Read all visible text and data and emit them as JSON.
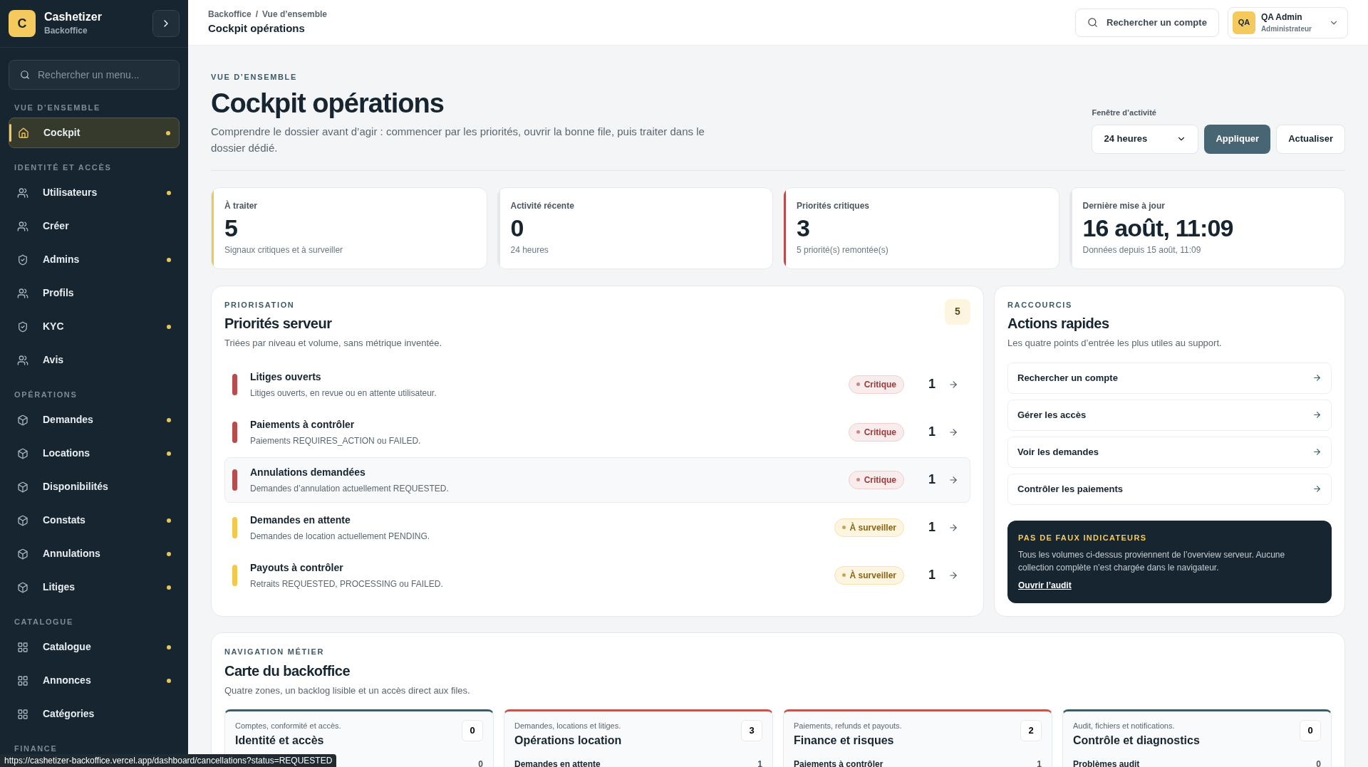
{
  "brand": {
    "initial": "C",
    "name": "Cashetizer",
    "subtitle": "Backoffice"
  },
  "sidebar": {
    "search_placeholder": "Rechercher un menu...",
    "sections": [
      {
        "title": "VUE D’ENSEMBLE",
        "items": [
          {
            "label": "Cockpit",
            "kind": "home",
            "selected": true,
            "flagged": true
          }
        ]
      },
      {
        "title": "IDENTITÉ ET ACCÈS",
        "items": [
          {
            "label": "Utilisateurs",
            "kind": "users",
            "selected": false,
            "flagged": true
          },
          {
            "label": "Créer",
            "kind": "users",
            "selected": false,
            "flagged": false
          },
          {
            "label": "Admins",
            "kind": "shield",
            "selected": false,
            "flagged": true
          },
          {
            "label": "Profils",
            "kind": "users",
            "selected": false,
            "flagged": false
          },
          {
            "label": "KYC",
            "kind": "shield",
            "selected": false,
            "flagged": true
          },
          {
            "label": "Avis",
            "kind": "users",
            "selected": false,
            "flagged": false
          }
        ]
      },
      {
        "title": "OPÉRATIONS",
        "items": [
          {
            "label": "Demandes",
            "kind": "box",
            "selected": false,
            "flagged": true
          },
          {
            "label": "Locations",
            "kind": "box",
            "selected": false,
            "flagged": true
          },
          {
            "label": "Disponibilités",
            "kind": "box",
            "selected": false,
            "flagged": false
          },
          {
            "label": "Constats",
            "kind": "box",
            "selected": false,
            "flagged": true
          },
          {
            "label": "Annulations",
            "kind": "box",
            "selected": false,
            "flagged": true
          },
          {
            "label": "Litiges",
            "kind": "box",
            "selected": false,
            "flagged": true
          }
        ]
      },
      {
        "title": "CATALOGUE",
        "items": [
          {
            "label": "Catalogue",
            "kind": "grid",
            "selected": false,
            "flagged": true
          },
          {
            "label": "Annonces",
            "kind": "grid",
            "selected": false,
            "flagged": true
          },
          {
            "label": "Catégories",
            "kind": "grid",
            "selected": false,
            "flagged": false
          }
        ]
      },
      {
        "title": "FINANCE"
      }
    ]
  },
  "header": {
    "breadcrumb": [
      "Backoffice",
      "Vue d’ensemble"
    ],
    "separator": "/",
    "title": "Cockpit opérations",
    "search_label": "Rechercher un compte",
    "user": {
      "initials": "QA",
      "name": "QA Admin",
      "role": "Administrateur"
    }
  },
  "hero": {
    "eyebrow": "VUE D’ENSEMBLE",
    "title": "Cockpit opérations",
    "description": "Comprendre le dossier avant d’agir : commencer par les priorités, ouvrir la bonne file, puis traiter dans le dossier dédié.",
    "window_label": "Fenêtre d’activité",
    "window_value": "24 heures",
    "apply": "Appliquer",
    "refresh": "Actualiser"
  },
  "kpis": [
    {
      "label": "À traiter",
      "value": "5",
      "note": "Signaux critiques et à surveiller",
      "color": "#f2c94c"
    },
    {
      "label": "Activité récente",
      "value": "0",
      "note": "24 heures",
      "color": "#e5e7eb"
    },
    {
      "label": "Priorités critiques",
      "value": "3",
      "note": "5 priorité(s) remontée(s)",
      "color": "#b84b4b"
    },
    {
      "label": "Dernière mise à jour",
      "value": "16 août, 11:09",
      "note": "Données depuis 15 août, 11:09",
      "color": "#e5e7eb"
    }
  ],
  "priorities": {
    "eyebrow": "PRIORISATION",
    "title": "Priorités serveur",
    "subtitle": "Triées par niveau et volume, sans métrique inventée.",
    "count": "5",
    "rows": [
      {
        "title": "Litiges ouverts",
        "detail": "Litiges ouverts, en revue ou en attente utilisateur.",
        "kind": "critical",
        "badge": "Critique",
        "count": "1",
        "selected": false
      },
      {
        "title": "Paiements à contrôler",
        "detail": "Paiements REQUIRES_ACTION ou FAILED.",
        "kind": "critical",
        "badge": "Critique",
        "count": "1",
        "selected": false
      },
      {
        "title": "Annulations demandées",
        "detail": "Demandes d’annulation actuellement REQUESTED.",
        "kind": "critical",
        "badge": "Critique",
        "count": "1",
        "selected": true
      },
      {
        "title": "Demandes en attente",
        "detail": "Demandes de location actuellement PENDING.",
        "kind": "watch",
        "badge": "À surveiller",
        "count": "1",
        "selected": false
      },
      {
        "title": "Payouts à contrôler",
        "detail": "Retraits REQUESTED, PROCESSING ou FAILED.",
        "kind": "watch",
        "badge": "À surveiller",
        "count": "1",
        "selected": false
      }
    ]
  },
  "shortcuts": {
    "eyebrow": "RACCOURCIS",
    "title": "Actions rapides",
    "subtitle": "Les quatre points d’entrée les plus utiles au support.",
    "actions": [
      "Rechercher un compte",
      "Gérer les accès",
      "Voir les demandes",
      "Contrôler les paiements"
    ],
    "notice": {
      "title": "PAS DE FAUX INDICATEURS",
      "text": "Tous les volumes ci-dessus proviennent de l’overview serveur. Aucune collection complète n’est chargée dans le navigateur.",
      "link": "Ouvrir l’audit"
    }
  },
  "navigation": {
    "eyebrow": "NAVIGATION MÉTIER",
    "title": "Carte du backoffice",
    "subtitle": "Quatre zones, un backlog lisible et un accès direct aux files.",
    "zones": [
      {
        "caption": "Comptes, conformité et accès.",
        "title": "Identité et accès",
        "count": "0",
        "color": "#3e5a66",
        "rows": [
          {
            "value": "0"
          }
        ]
      },
      {
        "caption": "Demandes, locations et litiges.",
        "title": "Opérations location",
        "count": "3",
        "color": "#c0564f",
        "rows": [
          {
            "label": "Demandes en attente",
            "value": "1"
          }
        ]
      },
      {
        "caption": "Paiements, refunds et payouts.",
        "title": "Finance et risques",
        "count": "2",
        "color": "#c0564f",
        "rows": [
          {
            "label": "Paiements à contrôler",
            "value": "1"
          }
        ]
      },
      {
        "caption": "Audit, fichiers et notifications.",
        "title": "Contrôle et diagnostics",
        "count": "0",
        "color": "#3e5a66",
        "rows": [
          {
            "label": "Problèmes audit",
            "value": "0"
          }
        ]
      }
    ]
  },
  "status_url": "https://cashetizer-backoffice.vercel.app/dashboard/cancellations?status=REQUESTED"
}
